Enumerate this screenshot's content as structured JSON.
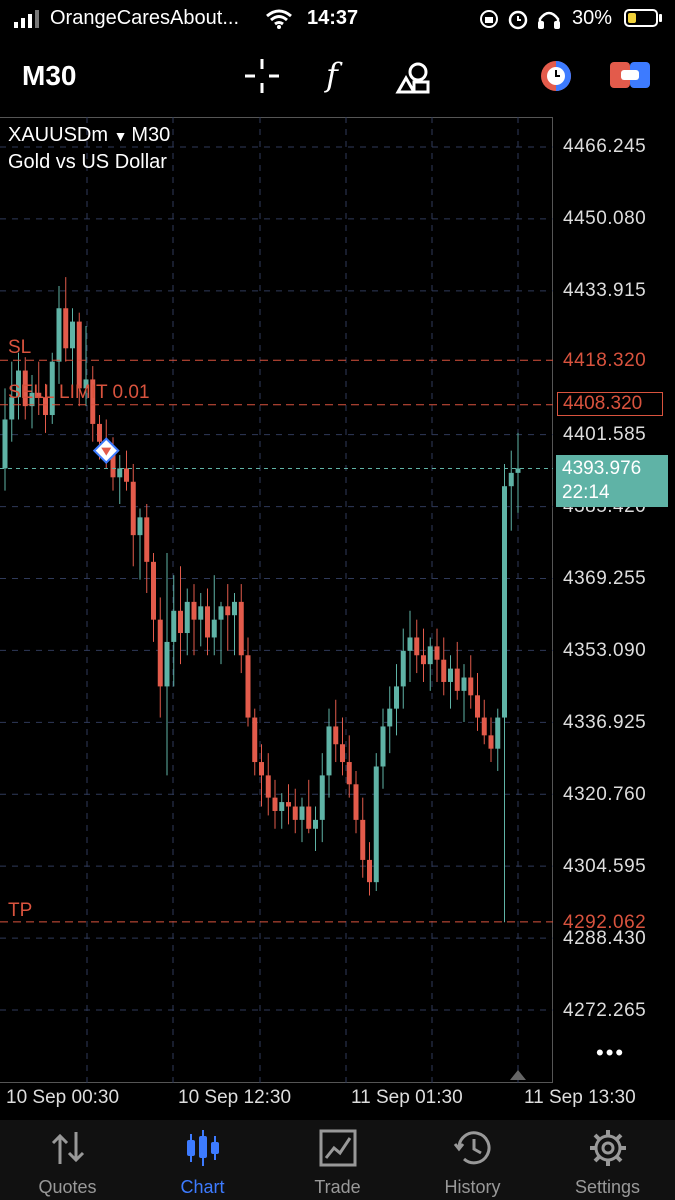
{
  "status_bar": {
    "carrier": "OrangeCaresAbout...",
    "time": "14:37",
    "battery_pct": "30%",
    "battery_level": 0.3,
    "signal_icon": "signal-bars-icon",
    "wifi_icon": "wifi-icon"
  },
  "toolbar": {
    "timeframe": "M30",
    "icons": [
      "crosshair-icon",
      "indicator-f-icon",
      "objects-icon",
      "trade-timer-icon",
      "one-click-trading-icon"
    ]
  },
  "chart": {
    "symbol": "XAUUSDm",
    "timeframe": "M30",
    "description": "Gold vs US Dollar",
    "price_labels": [
      "4466.245",
      "4450.080",
      "4433.915",
      "4401.585",
      "4385.420",
      "4369.255",
      "4353.090",
      "4336.925",
      "4320.760",
      "4304.595",
      "4288.430",
      "4272.265"
    ],
    "time_labels": [
      "10 Sep 00:30",
      "10 Sep 12:30",
      "11 Sep 01:30",
      "11 Sep 13:30"
    ],
    "orders": {
      "sl_label": "SL",
      "sl_price": "4418.320",
      "sell_limit_label": "SELL LIMIT 0.01",
      "sell_limit_price": "4408.320",
      "tp_label": "TP",
      "tp_price": "4292.062"
    },
    "current_price": "4393.976",
    "countdown": "22:14",
    "colors": {
      "bull": "#5fb3a6",
      "bear": "#e35b4b",
      "order_line": "#d9533e",
      "grid": "#2f3a5a"
    }
  },
  "chart_data": {
    "type": "candlestick",
    "symbol": "XAUUSDm",
    "timeframe": "M30",
    "ylim": [
      4265,
      4475
    ],
    "candles": [
      [
        4394,
        4412,
        4389,
        4405
      ],
      [
        4405,
        4418,
        4400,
        4410
      ],
      [
        4410,
        4420,
        4405,
        4416
      ],
      [
        4416,
        4419,
        4405,
        4408
      ],
      [
        4408,
        4415,
        4403,
        4411
      ],
      [
        4411,
        4418,
        4406,
        4410
      ],
      [
        4410,
        4413,
        4402,
        4406
      ],
      [
        4406,
        4420,
        4404,
        4418
      ],
      [
        4418,
        4435,
        4413,
        4430
      ],
      [
        4430,
        4437,
        4418,
        4421
      ],
      [
        4421,
        4430,
        4410,
        4427
      ],
      [
        4427,
        4429,
        4408,
        4412
      ],
      [
        4412,
        4426,
        4408,
        4414
      ],
      [
        4414,
        4417,
        4400,
        4404
      ],
      [
        4404,
        4406,
        4396,
        4400
      ],
      [
        4400,
        4405,
        4394,
        4398
      ],
      [
        4398,
        4401,
        4389,
        4392
      ],
      [
        4392,
        4397,
        4386,
        4394
      ],
      [
        4394,
        4398,
        4389,
        4391
      ],
      [
        4391,
        4395,
        4372,
        4379
      ],
      [
        4379,
        4385,
        4369,
        4383
      ],
      [
        4383,
        4386,
        4366,
        4373
      ],
      [
        4373,
        4375,
        4355,
        4360
      ],
      [
        4360,
        4365,
        4338,
        4345
      ],
      [
        4345,
        4375,
        4325,
        4355
      ],
      [
        4355,
        4370,
        4345,
        4362
      ],
      [
        4362,
        4372,
        4350,
        4357
      ],
      [
        4357,
        4367,
        4352,
        4364
      ],
      [
        4364,
        4368,
        4352,
        4360
      ],
      [
        4360,
        4366,
        4354,
        4363
      ],
      [
        4363,
        4367,
        4352,
        4356
      ],
      [
        4356,
        4370,
        4352,
        4360
      ],
      [
        4360,
        4364,
        4350,
        4363
      ],
      [
        4363,
        4368,
        4353,
        4361
      ],
      [
        4361,
        4366,
        4352,
        4364
      ],
      [
        4364,
        4368,
        4348,
        4352
      ],
      [
        4352,
        4356,
        4336,
        4338
      ],
      [
        4338,
        4340,
        4325,
        4328
      ],
      [
        4328,
        4332,
        4318,
        4325
      ],
      [
        4325,
        4330,
        4316,
        4320
      ],
      [
        4320,
        4324,
        4313,
        4317
      ],
      [
        4317,
        4321,
        4313,
        4319
      ],
      [
        4319,
        4323,
        4314,
        4318
      ],
      [
        4318,
        4322,
        4312,
        4315
      ],
      [
        4315,
        4320,
        4310,
        4318
      ],
      [
        4318,
        4324,
        4312,
        4313
      ],
      [
        4313,
        4318,
        4308,
        4315
      ],
      [
        4315,
        4330,
        4310,
        4325
      ],
      [
        4325,
        4340,
        4320,
        4336
      ],
      [
        4336,
        4342,
        4328,
        4332
      ],
      [
        4332,
        4338,
        4325,
        4328
      ],
      [
        4328,
        4334,
        4320,
        4323
      ],
      [
        4323,
        4326,
        4312,
        4315
      ],
      [
        4315,
        4320,
        4302,
        4306
      ],
      [
        4306,
        4310,
        4298,
        4301
      ],
      [
        4301,
        4330,
        4299,
        4327
      ],
      [
        4327,
        4340,
        4322,
        4336
      ],
      [
        4336,
        4345,
        4330,
        4340
      ],
      [
        4340,
        4350,
        4334,
        4345
      ],
      [
        4345,
        4358,
        4340,
        4353
      ],
      [
        4353,
        4362,
        4346,
        4356
      ],
      [
        4356,
        4360,
        4348,
        4352
      ],
      [
        4352,
        4358,
        4346,
        4350
      ],
      [
        4350,
        4356,
        4344,
        4354
      ],
      [
        4354,
        4358,
        4346,
        4351
      ],
      [
        4351,
        4356,
        4343,
        4346
      ],
      [
        4346,
        4352,
        4340,
        4349
      ],
      [
        4349,
        4355,
        4342,
        4344
      ],
      [
        4344,
        4350,
        4337,
        4347
      ],
      [
        4347,
        4352,
        4340,
        4343
      ],
      [
        4343,
        4348,
        4335,
        4338
      ],
      [
        4338,
        4342,
        4332,
        4334
      ],
      [
        4334,
        4338,
        4328,
        4331
      ],
      [
        4331,
        4340,
        4326,
        4338
      ],
      [
        4338,
        4395,
        4292,
        4390
      ],
      [
        4390,
        4398,
        4380,
        4393
      ],
      [
        4393,
        4402,
        4384,
        4394
      ]
    ]
  },
  "nav": {
    "items": [
      {
        "label": "Quotes",
        "icon": "quotes-arrows-icon",
        "active": false
      },
      {
        "label": "Chart",
        "icon": "chart-candles-icon",
        "active": true
      },
      {
        "label": "Trade",
        "icon": "trade-chart-icon",
        "active": false
      },
      {
        "label": "History",
        "icon": "history-clock-icon",
        "active": false
      },
      {
        "label": "Settings",
        "icon": "settings-gear-icon",
        "active": false
      }
    ]
  }
}
